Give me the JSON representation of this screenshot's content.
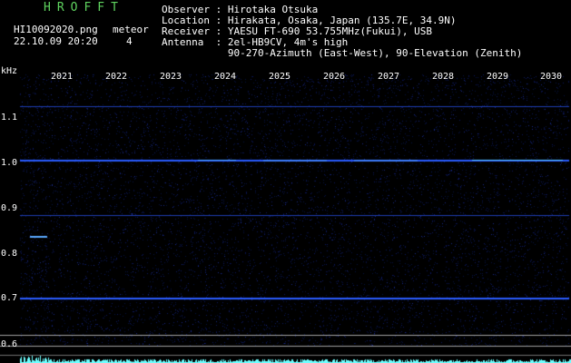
{
  "header": {
    "program": "HROFFT",
    "filename": "HI10092020.png",
    "datetime": "22.10.09 20:20",
    "count_label": "meteor",
    "count_value": "4",
    "observer": "Observer : Hirotaka Otsuka",
    "location": "Location : Hirakata, Osaka, Japan (135.7E, 34.9N)",
    "receiver": "Receiver : YAESU FT-690 53.755MHz(Fukui), USB",
    "antenna": "Antenna  : 2el-HB9CV, 4m's high",
    "antenna2": "           90-270-Azimuth (East-West), 90-Elevation (Zenith)"
  },
  "axes": {
    "y_unit": "kHz",
    "y_ticks": [
      "1.1",
      "1.0",
      "0.9",
      "0.8",
      "0.7",
      "0.6"
    ],
    "x_ticks": [
      "2021",
      "2022",
      "2023",
      "2024",
      "2025",
      "2026",
      "2027",
      "2028",
      "2029",
      "2030"
    ]
  },
  "colors": {
    "background": "#000000",
    "noise": "#0a1450",
    "carrier": "#2a5bff",
    "bright": "#6fffff",
    "baseline": "#a0a0a0",
    "text": "#ffffff",
    "title": "#5fd35f"
  }
}
